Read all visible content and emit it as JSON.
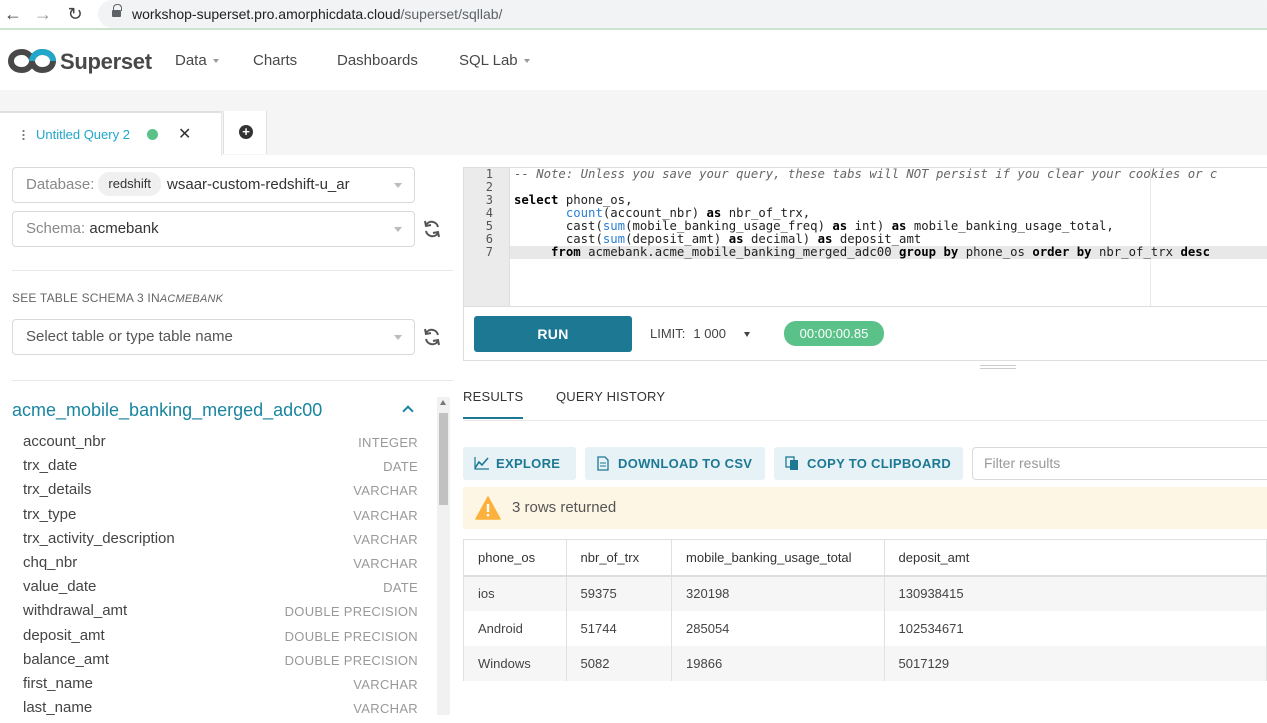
{
  "browser": {
    "url_host": "workshop-superset.pro.amorphicdata.cloud",
    "url_path": "/superset/sqllab/"
  },
  "nav": {
    "brand": "Superset",
    "items": [
      {
        "label": "Data",
        "dropdown": true
      },
      {
        "label": "Charts",
        "dropdown": false
      },
      {
        "label": "Dashboards",
        "dropdown": false
      },
      {
        "label": "SQL Lab",
        "dropdown": true
      }
    ]
  },
  "query_tab": {
    "label": "Untitled Query 2",
    "status_color": "#5ac189"
  },
  "left_panel": {
    "database_label": "Database:",
    "database_badge": "redshift",
    "database_value": "wsaar-custom-redshift-u_ar",
    "schema_label": "Schema:",
    "schema_value": "acmebank",
    "table_schema_heading": "SEE TABLE SCHEMA",
    "table_schema_count": "3 IN",
    "table_schema_name": "ACMEBANK",
    "table_select_placeholder": "Select table or type table name",
    "table_name": "acme_mobile_banking_merged_adc00",
    "columns": [
      {
        "name": "account_nbr",
        "type": "INTEGER"
      },
      {
        "name": "trx_date",
        "type": "DATE"
      },
      {
        "name": "trx_details",
        "type": "VARCHAR"
      },
      {
        "name": "trx_type",
        "type": "VARCHAR"
      },
      {
        "name": "trx_activity_description",
        "type": "VARCHAR"
      },
      {
        "name": "chq_nbr",
        "type": "VARCHAR"
      },
      {
        "name": "value_date",
        "type": "DATE"
      },
      {
        "name": "withdrawal_amt",
        "type": "DOUBLE PRECISION"
      },
      {
        "name": "deposit_amt",
        "type": "DOUBLE PRECISION"
      },
      {
        "name": "balance_amt",
        "type": "DOUBLE PRECISION"
      },
      {
        "name": "first_name",
        "type": "VARCHAR"
      },
      {
        "name": "last_name",
        "type": "VARCHAR"
      }
    ]
  },
  "editor": {
    "line_numbers": [
      "1",
      "2",
      "3",
      "4",
      "5",
      "6",
      "7"
    ],
    "lines": [
      "-- Note: Unless you save your query, these tabs will NOT persist if you clear your cookies or c",
      "",
      "select phone_os,",
      "       count(account_nbr) as nbr_of_trx,",
      "       cast(sum(mobile_banking_usage_freq) as int) as mobile_banking_usage_total,",
      "       cast(sum(deposit_amt) as decimal) as deposit_amt",
      "     from acmebank.acme_mobile_banking_merged_adc00 group by phone_os order by nbr_of_trx desc"
    ],
    "active_line": 7
  },
  "run_bar": {
    "run_label": "RUN",
    "limit_label": "LIMIT:",
    "limit_value": "1 000",
    "timer": "00:00:00.85"
  },
  "results_tabs": {
    "results": "RESULTS",
    "history": "QUERY HISTORY"
  },
  "actions": {
    "explore": "EXPLORE",
    "download": "DOWNLOAD TO CSV",
    "copy": "COPY TO CLIPBOARD",
    "filter_placeholder": "Filter results"
  },
  "alert": {
    "message": "3 rows returned",
    "icon_color": "#fbb13c"
  },
  "results_table": {
    "headers": [
      "phone_os",
      "nbr_of_trx",
      "mobile_banking_usage_total",
      "deposit_amt"
    ],
    "rows": [
      [
        "ios",
        "59375",
        "320198",
        "130938415"
      ],
      [
        "Android",
        "51744",
        "285054",
        "102534671"
      ],
      [
        "Windows",
        "5082",
        "19866",
        "5017129"
      ]
    ]
  },
  "colors": {
    "primary": "#1c7893",
    "link": "#20a7c9",
    "success": "#5ac189"
  }
}
